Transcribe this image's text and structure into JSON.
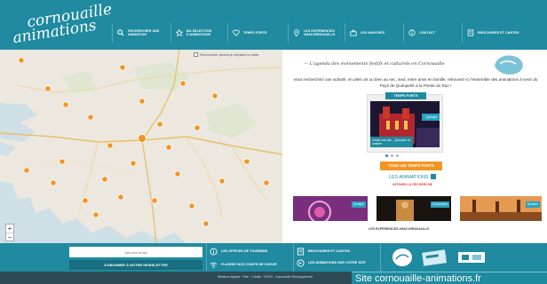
{
  "logo": {
    "line1": "cornouaille",
    "line2": "animations"
  },
  "nav": [
    {
      "icon": "search-icon",
      "label": "Rechercher une animation"
    },
    {
      "icon": "star-icon",
      "label": "Ma sélection d'animations"
    },
    {
      "icon": "heart-icon",
      "label": "Temps forts"
    },
    {
      "icon": "pin-icon",
      "label": "Les expériences #macornouaille"
    },
    {
      "icon": "basket-icon",
      "label": "Les marchés"
    },
    {
      "icon": "info-icon",
      "label": "Contact"
    },
    {
      "icon": "book-icon",
      "label": "Brochures et cartes"
    }
  ],
  "map": {
    "search_toggle": "Rechercher quand je déplace la carte",
    "zoom_in": "+",
    "zoom_out": "−"
  },
  "panel": {
    "tagline": "— L'agenda des événements festifs et culturels en Cornouaille",
    "intro": "Vous recherchez une activité, en plein air ou bien au sec, seul, entre amis en famille, retrouvez ici l'ensemble des animations à venir du Pays de Quimperlé à la Pointe du Raz !",
    "slider": {
      "tab": "TEMPS FORTS",
      "badge": "Quimper",
      "caption": "Il était une fois... Quimper en lumière"
    },
    "temps_forts_button": "TOUS LES TEMPS FORTS",
    "animations_title": "LES ANIMATIONS",
    "animations_sub": "AFFINER LA RECHERCHE",
    "thumbs": [
      {
        "badge": "Quimper"
      },
      {
        "badge": "Concarneau"
      },
      {
        "badge": "Quimper"
      }
    ],
    "experiences_link": "LES EXPÉRIENCES #MACORNOUAILLE"
  },
  "footer": {
    "newsletter_placeholder": "Adresse email",
    "newsletter_button": "S'abonner à notre newsletter",
    "links": [
      {
        "icon": "info-icon",
        "label": "Les offices de tourisme"
      },
      {
        "icon": "book-icon",
        "label": "Brochures et cartes"
      },
      {
        "icon": "wifi-icon",
        "label": "Flashez nos coups de coeur"
      },
      {
        "icon": "share-icon",
        "label": "Les animations sur votre site"
      }
    ]
  },
  "bottom": {
    "credits": "Mentions légales  ·  Plan  ·  Crédits  ·  ©2019 - Cornouaille Développement",
    "site_link": "Site cornouaille-animations.fr"
  },
  "colors": {
    "primary": "#1f8aa0",
    "orange": "#f29623",
    "dark": "#2d4a56",
    "red": "#e0453b"
  }
}
